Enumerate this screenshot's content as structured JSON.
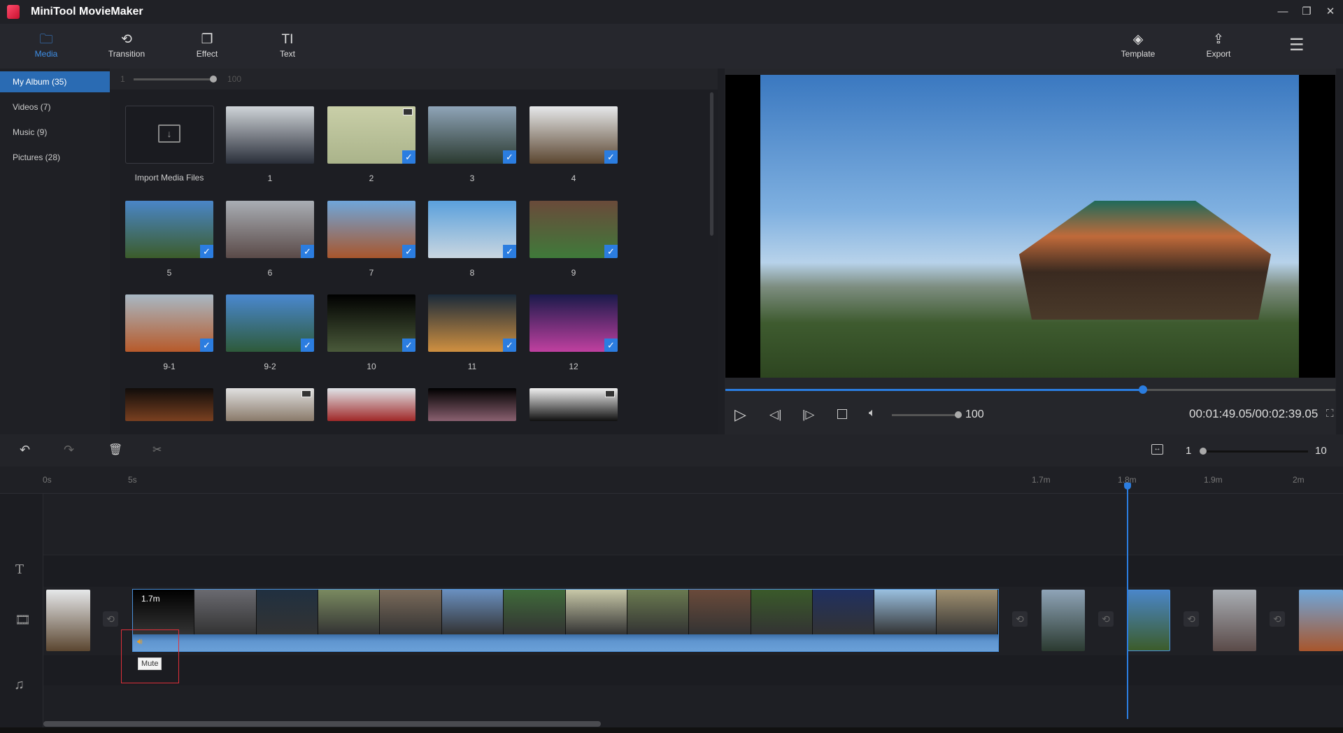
{
  "app": {
    "title": "MiniTool MovieMaker",
    "window_buttons": [
      "—",
      "❐",
      "✕"
    ]
  },
  "toolbar": {
    "tabs": [
      {
        "label": "Media",
        "icon": "folder-icon",
        "glyph": "🗀",
        "active": true
      },
      {
        "label": "Transition",
        "icon": "transition-icon",
        "glyph": "⟲"
      },
      {
        "label": "Effect",
        "icon": "effect-icon",
        "glyph": "❐"
      },
      {
        "label": "Text",
        "icon": "text-icon",
        "glyph": "TI"
      }
    ],
    "right": [
      {
        "label": "Template",
        "icon": "template-icon",
        "glyph": "◈"
      },
      {
        "label": "Export",
        "icon": "export-icon",
        "glyph": "⇪"
      }
    ],
    "menu_glyph": "☰"
  },
  "sidebar": {
    "items": [
      {
        "label": "My Album  (35)",
        "active": true
      },
      {
        "label": "Videos  (7)"
      },
      {
        "label": "Music  (9)"
      },
      {
        "label": "Pictures  (28)"
      }
    ]
  },
  "media": {
    "size_min": "1",
    "size_max": "100",
    "import_label": "Import Media Files",
    "items": [
      {
        "label": "1",
        "c": [
          "#cfd4d8",
          "#2a2f3a"
        ],
        "checked": false
      },
      {
        "label": "2",
        "c": [
          "#c9cfa8",
          "#aab38a"
        ],
        "checked": true,
        "video": true
      },
      {
        "label": "3",
        "c": [
          "#8fa4b8",
          "#2b3a30"
        ],
        "checked": true
      },
      {
        "label": "4",
        "c": [
          "#e6e8ea",
          "#5b4630"
        ],
        "checked": true
      },
      {
        "label": "5",
        "c": [
          "#4a86c8",
          "#3c5c2a"
        ],
        "checked": true
      },
      {
        "label": "6",
        "c": [
          "#a9aeb4",
          "#5a4a48"
        ],
        "checked": true
      },
      {
        "label": "7",
        "c": [
          "#6fa6da",
          "#a8562c"
        ],
        "checked": true
      },
      {
        "label": "8",
        "c": [
          "#5aa0dc",
          "#c9d6e0"
        ],
        "checked": true
      },
      {
        "label": "9",
        "c": [
          "#6a4a3a",
          "#3f7a3a"
        ],
        "checked": true
      },
      {
        "label": "9-1",
        "c": [
          "#a8b8c4",
          "#b75a2a"
        ],
        "checked": true
      },
      {
        "label": "9-2",
        "c": [
          "#4a88d0",
          "#2e5a3a"
        ],
        "checked": true
      },
      {
        "label": "10",
        "c": [
          "#000000",
          "#4a5a3a"
        ],
        "checked": true
      },
      {
        "label": "11",
        "c": [
          "#1a2a3a",
          "#d09040"
        ],
        "checked": true
      },
      {
        "label": "12",
        "c": [
          "#1a1a4a",
          "#c040a0"
        ],
        "checked": true
      },
      {
        "label": "",
        "c": [
          "#100c0a",
          "#7a4020"
        ],
        "checked": false
      },
      {
        "label": "",
        "c": [
          "#e0e0e0",
          "#8a7a6a"
        ],
        "checked": false,
        "video": true
      },
      {
        "label": "",
        "c": [
          "#e0e4e8",
          "#a02828"
        ],
        "checked": false
      },
      {
        "label": "",
        "c": [
          "#000000",
          "#8a6070"
        ],
        "checked": false
      },
      {
        "label": "",
        "c": [
          "#f0f0f0",
          "#101010"
        ],
        "checked": false,
        "video": true
      }
    ]
  },
  "player": {
    "progress": 0.685,
    "volume": "100",
    "volume_fraction": 1,
    "time": "00:01:49.05/00:02:39.05"
  },
  "timeline": {
    "zoom_min": "1",
    "zoom_max": "10",
    "zoom_fraction": 0,
    "ruler": [
      {
        "t": "0s"
      },
      {
        "t": "5s"
      },
      {
        "t": "1.7m"
      },
      {
        "t": "1.8m"
      },
      {
        "t": "1.9m"
      },
      {
        "t": "2m"
      }
    ],
    "clip_duration": "1.7m",
    "tooltip": "Mute",
    "strip": [
      "#000",
      "#6a6a70",
      "#203040",
      "#7a8a60",
      "#7a6a5a",
      "#6a90c0",
      "#3f6a3a",
      "#c8c8a8",
      "#6a7a50",
      "#6a4a3a",
      "#3a5a2a",
      "#203060",
      "#9ac0e0",
      "#a09070"
    ]
  },
  "colors": {
    "accent": "#2b7de0",
    "highlight": "#e0303a"
  }
}
